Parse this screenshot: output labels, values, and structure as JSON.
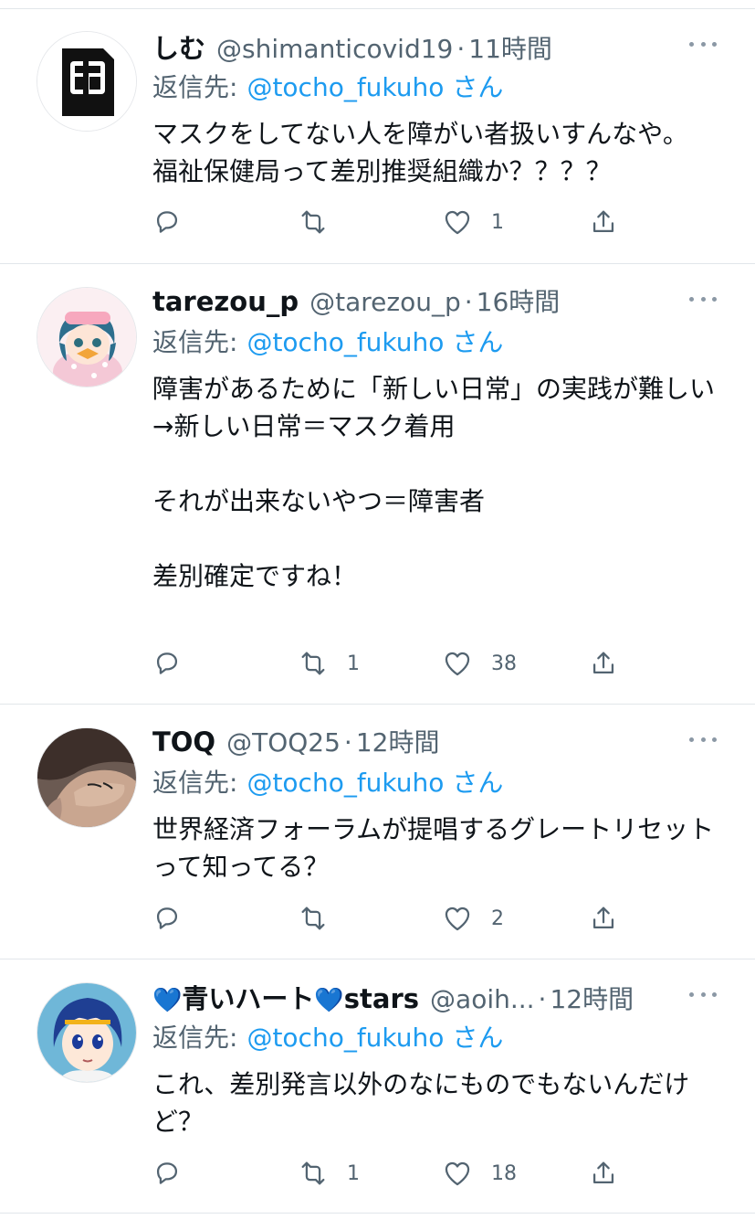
{
  "reply_prefix": "返信先:",
  "tweets": [
    {
      "display_name": "しむ",
      "handle": "@shimanticovid19",
      "separator": "·",
      "time": "11時間",
      "reply_mention": "@tocho_fukuho",
      "reply_suffix": "さん",
      "text": "マスクをしてない人を障がい者扱いすんなや。\n福祉保健局って差別推奨組織か？？？？",
      "replies": "",
      "retweets": "",
      "likes": "1"
    },
    {
      "display_name": "tarezou_p",
      "handle": "@tarezou_p",
      "separator": "·",
      "time": "16時間",
      "reply_mention": "@tocho_fukuho",
      "reply_suffix": "さん",
      "text": "障害があるために「新しい日常」の実践が難しい\n→新しい日常＝マスク着用\n\nそれが出来ないやつ＝障害者\n\n差別確定ですね！",
      "replies": "",
      "retweets": "1",
      "likes": "38"
    },
    {
      "display_name": "TOQ",
      "handle": "@TOQ25",
      "separator": "·",
      "time": "12時間",
      "reply_mention": "@tocho_fukuho",
      "reply_suffix": "さん",
      "text": "世界経済フォーラムが提唱するグレートリセットって知ってる？",
      "replies": "",
      "retweets": "",
      "likes": "2"
    },
    {
      "display_name_parts": [
        "💙",
        "青いハート",
        "💙",
        "stars"
      ],
      "handle": "@aoih...",
      "separator": "·",
      "time": "12時間",
      "reply_mention": "@tocho_fukuho",
      "reply_suffix": "さん",
      "text": "これ、差別発言以外のなにものでもないんだけど？",
      "replies": "",
      "retweets": "1",
      "likes": "18"
    }
  ],
  "icons": [
    "reply-icon",
    "retweet-icon",
    "like-icon",
    "share-icon",
    "more-icon"
  ],
  "colors": {
    "accent": "#1d9bf0",
    "secondary_text": "#536471",
    "divider": "#e1e6ea"
  }
}
